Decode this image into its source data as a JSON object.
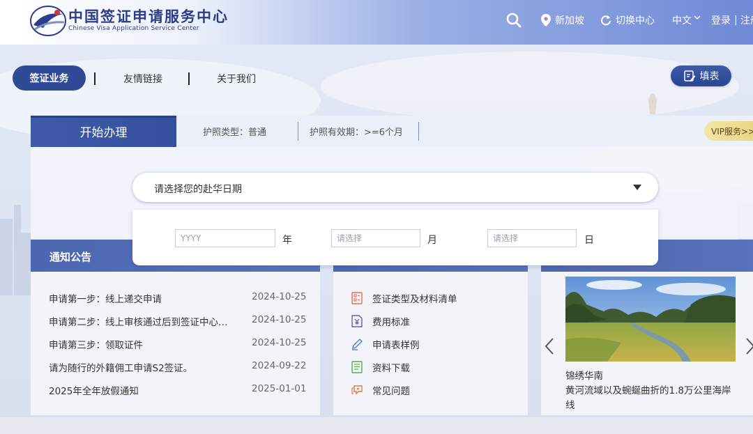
{
  "header": {
    "brand_cn": "中国签证申请服务中心",
    "brand_en": "Chinese Visa Application Service Center",
    "location": "新加坡",
    "switch_center": "切换中心",
    "language": "中文",
    "login": "登录",
    "register": "注册",
    "separator": "|",
    "icons": [
      "search-icon",
      "location-pin-icon",
      "refresh-icon",
      "chevron-down-icon"
    ]
  },
  "nav": {
    "visa_business": "签证业务",
    "friendly_links": "友情链接",
    "about_us": "关于我们",
    "fill_form": "填表"
  },
  "start": {
    "tab": "开始办理",
    "passport_type": "护照类型：普通",
    "passport_validity": "护照有效期：>=6个月",
    "vip": "VIP服务>>"
  },
  "date_select": {
    "placeholder": "请选择您的赴华日期",
    "year_placeholder": "YYYY",
    "year_unit": "年",
    "month_placeholder": "请选择",
    "month_unit": "月",
    "day_placeholder": "请选择",
    "day_unit": "日"
  },
  "notices": {
    "title": "通知公告",
    "items": [
      {
        "title": "申请第一步：线上递交申请",
        "date": "2024-10-25"
      },
      {
        "title": "申请第二步：线上审核通过后到签证中心…",
        "date": "2024-10-25"
      },
      {
        "title": "申请第三步：领取证件",
        "date": "2024-10-25"
      },
      {
        "title": "请为随行的外籍佣工申请S2签证。",
        "date": "2024-09-22"
      },
      {
        "title": "2025年全年放假通知",
        "date": "2025-01-01"
      }
    ]
  },
  "services": {
    "items": [
      {
        "label": "签证类型及材料清单",
        "icon": "checklist-icon"
      },
      {
        "label": "费用标准",
        "icon": "yuan-document-icon"
      },
      {
        "label": "申请表样例",
        "icon": "pen-icon"
      },
      {
        "label": "资料下载",
        "icon": "document-icon"
      },
      {
        "label": "常见问题",
        "icon": "question-chat-icon"
      }
    ]
  },
  "carousel": {
    "caption_title": "锦绣华南",
    "caption_text": "黄河流域以及蜿蜒曲折的1.8万公里海岸线"
  },
  "colors": {
    "primary": "#2f4a96",
    "header_gradient_end": "#6f89d6",
    "vip_gold": "#e9d17a"
  }
}
